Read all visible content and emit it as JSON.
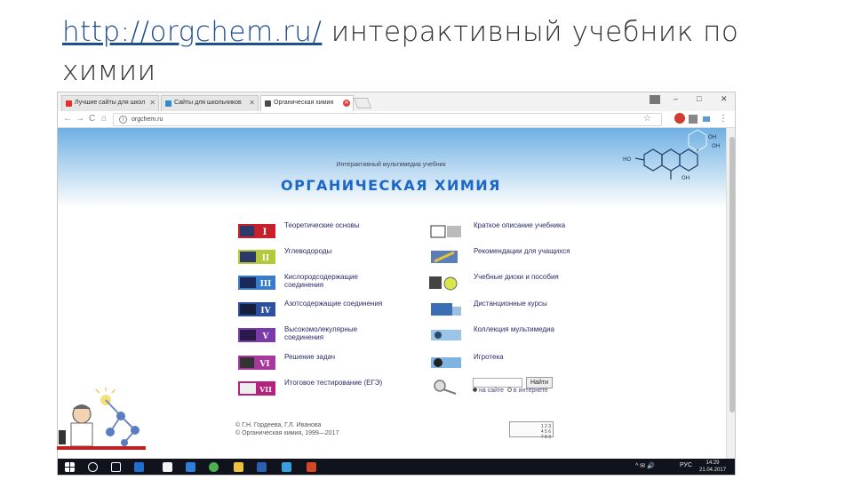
{
  "slide": {
    "title_link": "http://orgchem.ru/",
    "title_rest": " интерактивный учебник по химии"
  },
  "browser": {
    "tabs": [
      {
        "label": "Лучшие сайты для школ",
        "favicon": "yandex-icon",
        "color": "#e5302b",
        "active": false
      },
      {
        "label": "Сайты для школьников",
        "favicon": "chat-icon",
        "color": "#2e8bd6",
        "active": false
      },
      {
        "label": "Органическая химия",
        "favicon": "molecule-icon",
        "color": "#4a4a4a",
        "active": true
      }
    ],
    "window_controls": [
      "–",
      "□",
      "✕"
    ],
    "nav": {
      "back": "←",
      "forward": "→",
      "reload": "C",
      "home": "⌂"
    },
    "url": "orgchem.ru",
    "menu": "⋮"
  },
  "page": {
    "subtitle": "Интерактивный мультимедиа учебник",
    "title": "ОРГАНИЧЕСКАЯ ХИМИЯ",
    "molecule_labels": [
      "OH",
      "OH",
      "HO",
      "OH"
    ],
    "left_menu": [
      {
        "numeral": "I",
        "label": "Теоретические основы",
        "color": "#c8202a"
      },
      {
        "numeral": "II",
        "label": "Углеводороды",
        "color": "#b5c93a"
      },
      {
        "numeral": "III",
        "label": "Кислородсодержащие соединения",
        "color": "#3a7cc8"
      },
      {
        "numeral": "IV",
        "label": "Азотсодержащие соединения",
        "color": "#2d4fa0"
      },
      {
        "numeral": "V",
        "label": "Высокомолекулярные соединения",
        "color": "#7a3aa8"
      },
      {
        "numeral": "VI",
        "label": "Решение задач",
        "color": "#a8389c"
      },
      {
        "numeral": "VII",
        "label": "Итоговое тестирование (ЕГЭ)",
        "color": "#b3237e"
      }
    ],
    "right_menu": [
      {
        "label": "Краткое описание учебника",
        "icon": "textbook-icon"
      },
      {
        "label": "Рекомендации для учащихся",
        "icon": "pen-icon"
      },
      {
        "label": "Учебные диски и пособия",
        "icon": "disk-icon"
      },
      {
        "label": "Дистанционные курсы",
        "icon": "monitor-icon"
      },
      {
        "label": "Коллекция мультимедиа",
        "icon": "media-icon"
      },
      {
        "label": "Игротека",
        "icon": "game-icon"
      }
    ],
    "search": {
      "button": "Найти",
      "option_site": "на сайте",
      "option_web": "в интернете",
      "selected": "site"
    },
    "copyright": [
      "© Г.Н. Гордеева, Г.Л. Иванова",
      "© Органическая химия, 1999—2017"
    ],
    "counter_text": [
      "1 2 3",
      "4 5 6",
      "7 8 9"
    ]
  },
  "taskbar": {
    "lang": "РУС",
    "time": "14:29",
    "date": "21.04.2017",
    "systray": "^ ✉ 🔊"
  }
}
